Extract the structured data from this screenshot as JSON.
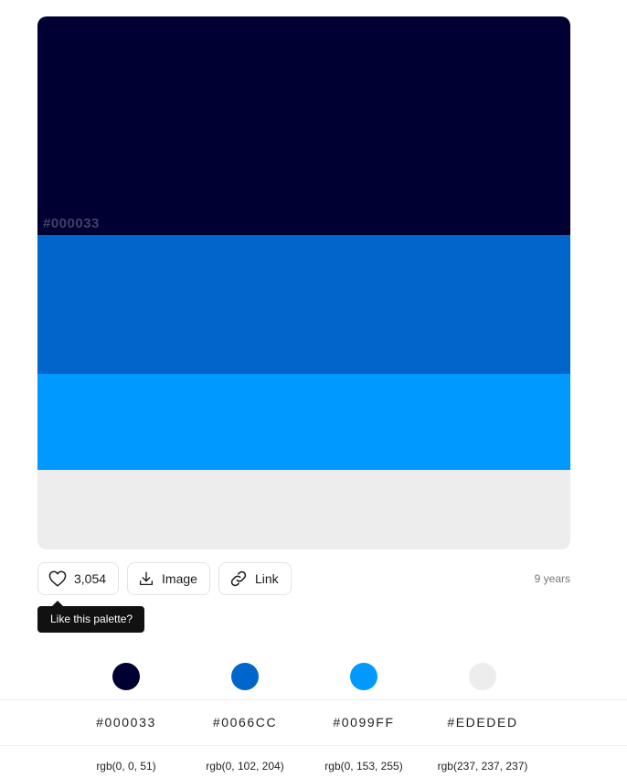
{
  "palette": {
    "swatches": [
      {
        "hex": "#000033",
        "label": "#000033",
        "share": 0.41
      },
      {
        "hex": "#0066CC",
        "label": "",
        "share": 0.26
      },
      {
        "hex": "#0099FF",
        "label": "",
        "share": 0.18
      },
      {
        "hex": "#EDEDED",
        "label": "",
        "share": 0.15
      }
    ]
  },
  "actions": {
    "likes": "3,054",
    "image_label": "Image",
    "link_label": "Link",
    "age": "9 years"
  },
  "tooltip": {
    "text": "Like this palette?"
  },
  "colors": [
    {
      "hex": "#000033",
      "rgb": "rgb(0, 0, 51)"
    },
    {
      "hex": "#0066CC",
      "rgb": "rgb(0, 102, 204)"
    },
    {
      "hex": "#0099FF",
      "rgb": "rgb(0, 153, 255)"
    },
    {
      "hex": "#EDEDED",
      "rgb": "rgb(237, 237, 237)"
    }
  ]
}
